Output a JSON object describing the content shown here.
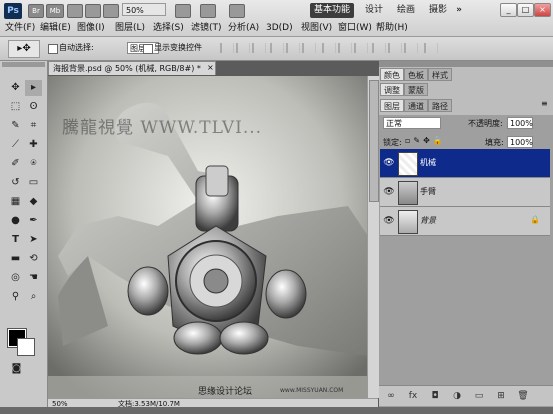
{
  "app": {
    "logo": "Ps",
    "toolbar_icons": [
      "Br",
      "Mb"
    ],
    "zoom": "50%",
    "workspace_buttons": [
      "基本功能",
      "设计",
      "绘画",
      "摄影"
    ],
    "window_controls": [
      "_",
      "□",
      "×"
    ]
  },
  "menu": [
    "文件(F)",
    "编辑(E)",
    "图像(I)",
    "图层(L)",
    "选择(S)",
    "滤镜(T)",
    "分析(A)",
    "3D(D)",
    "视图(V)",
    "窗口(W)",
    "帮助(H)"
  ],
  "options_bar": {
    "auto_select_label": "自动选择:",
    "auto_select_value": "图层",
    "show_transform_label": "显示变换控件"
  },
  "document": {
    "tab_title": "海报背景.psd @ 50% (机械, RGB/8#) *",
    "watermark": "騰龍視覺 WWW.TLVI...",
    "zoom_status": "50%",
    "file_info": "文档:3.53M/10.7M",
    "caption": "思缘设计论坛",
    "site": "www.MISSYUAN.COM"
  },
  "panels": {
    "top_tabs": [
      "颜色",
      "色板",
      "样式"
    ],
    "mid_tabs": [
      "调整",
      "蒙版"
    ],
    "layer_tabs": [
      "图层",
      "通道",
      "路径"
    ],
    "blend_mode": "正常",
    "opacity_label": "不透明度:",
    "opacity_value": "100%",
    "lock_label": "锁定:",
    "fill_label": "填充:",
    "fill_value": "100%",
    "layers": [
      {
        "name": "机械",
        "selected": true
      },
      {
        "name": "手臂",
        "selected": false
      },
      {
        "name": "背景",
        "selected": false
      }
    ]
  }
}
